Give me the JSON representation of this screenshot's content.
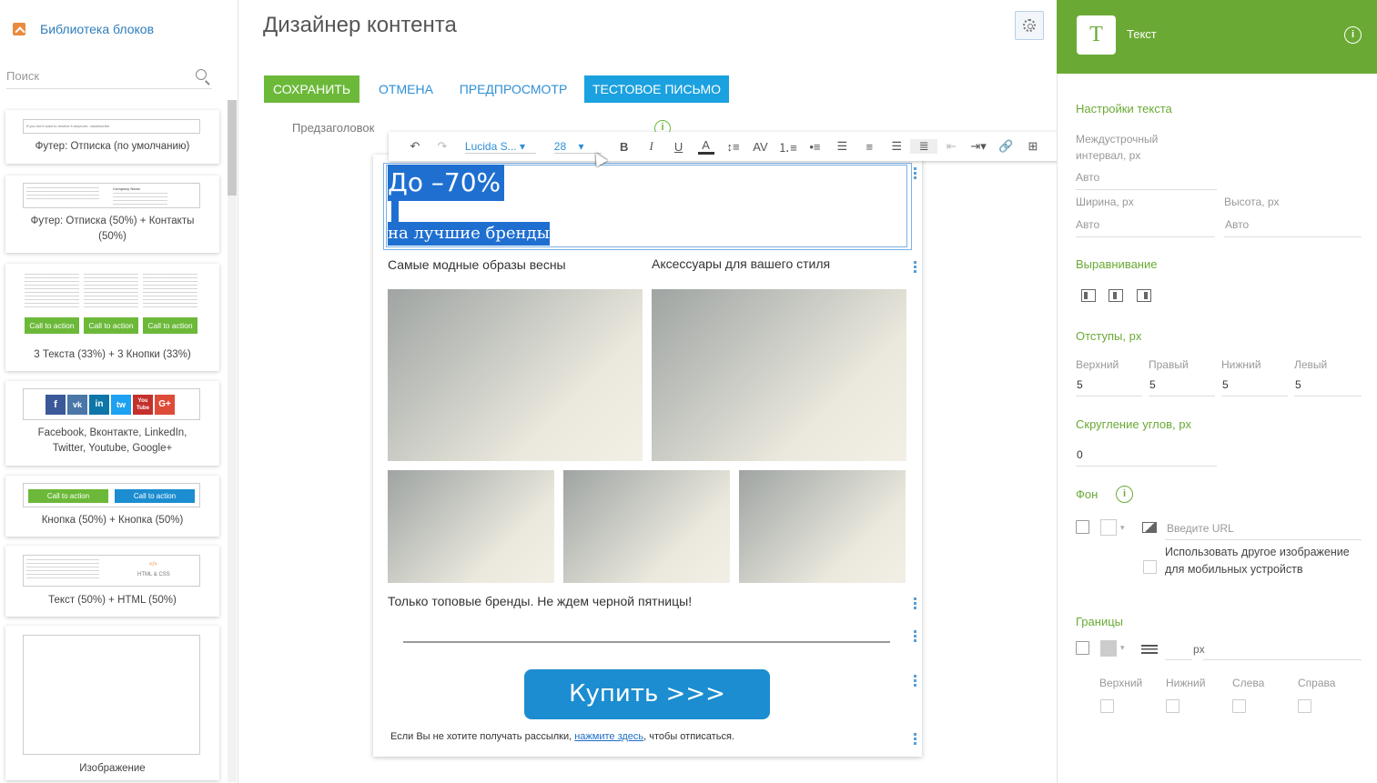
{
  "library": {
    "title": "Библиотека блоков",
    "search_placeholder": "Поиск",
    "blocks": [
      {
        "caption": "Футер: Отписка (по умолчанию)",
        "preview_text": "If you don't want to receive it anymore, unsubscribe."
      },
      {
        "caption": "Футер: Отписка (50%) + Контакты (50%)",
        "contact_title": "Company Name"
      },
      {
        "caption": "3 Текста (33%) + 3 Кнопки (33%)",
        "button": "Call to action"
      },
      {
        "caption": "Facebook, Вконтакте, LinkedIn, Twitter, Youtube, Google+"
      },
      {
        "caption": "Кнопка (50%) + Кнопка (50%)",
        "button": "Call to action"
      },
      {
        "caption": "Текст (50%) + HTML (50%)",
        "html_label": "HTML & CSS",
        "html_tag": "</>"
      },
      {
        "caption": "Изображение"
      }
    ],
    "social_icons": [
      "f",
      "vk",
      "in",
      "tw",
      "You Tube",
      "G+"
    ]
  },
  "designer": {
    "title": "Дизайнер контента",
    "toolbar": {
      "save": "СОХРАНИТЬ",
      "cancel": "ОТМЕНА",
      "preview": "ПРЕДПРОСМОТР",
      "test_email": "ТЕСТОВОЕ ПИСЬМО"
    },
    "preheader_label": "Предзаголовок",
    "rte": {
      "font": "Lucida S...",
      "size": "28"
    },
    "content": {
      "headline": "До –70%",
      "subheadline": "на лучшие бренды",
      "col_left_text": "Самые модные образы весны",
      "col_right_text": "Аксессуары для вашего стиля",
      "promo_text": "Только топовые бренды. Не ждем черной пятницы!",
      "buy_button": "Купить >>>",
      "unsub_before": "Если Вы не хотите получать рассылки, ",
      "unsub_link": "нажмите здесь",
      "unsub_after": ", чтобы отписаться."
    }
  },
  "panel": {
    "title": "Текст",
    "icon_letter": "T",
    "text_settings": "Настройки текста",
    "line_height_label": "Междустрочный интервал, px",
    "line_height_value": "Авто",
    "width_label": "Ширина, px",
    "width_value": "Авто",
    "height_label": "Высота, px",
    "height_value": "Авто",
    "alignment": "Выравнивание",
    "padding": "Отступы, px",
    "padding_top_label": "Верхний",
    "padding_right_label": "Правый",
    "padding_bottom_label": "Нижний",
    "padding_left_label": "Левый",
    "padding_top": "5",
    "padding_right": "5",
    "padding_bottom": "5",
    "padding_left": "5",
    "radius": "Скругление углов, px",
    "radius_value": "0",
    "background": "Фон",
    "url_placeholder": "Введите URL",
    "mobile_image": "Использовать другое изображение для мобильных устройств",
    "borders": "Границы",
    "border_unit": "px",
    "border_top": "Верхний",
    "border_bottom": "Нижний",
    "border_left": "Слева",
    "border_right": "Справа"
  },
  "colors": {
    "accent_green": "#6aaa34",
    "accent_blue": "#1ba1df",
    "selection": "#1f6fd1"
  }
}
